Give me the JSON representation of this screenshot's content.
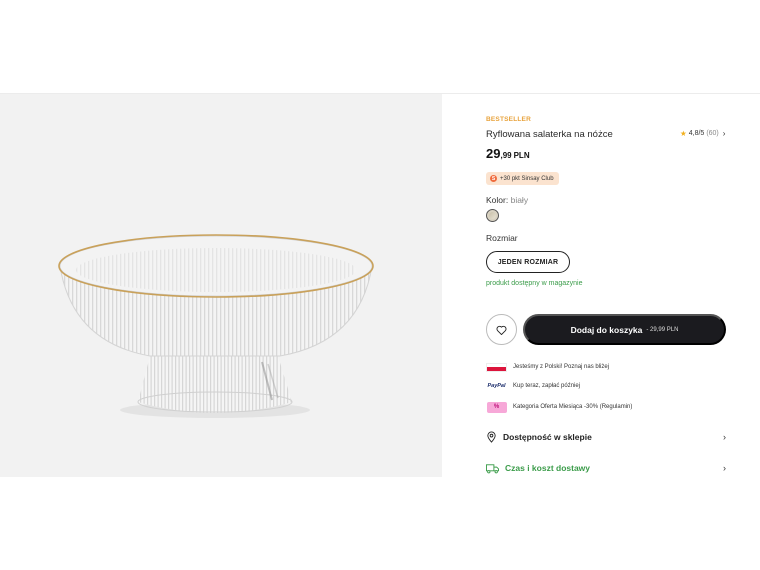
{
  "product": {
    "badge": "BESTSELLER",
    "title": "Ryflowana salaterka na nóżce",
    "rating": {
      "star_icon": "★",
      "score": "4,8/5",
      "count": "(60)",
      "chevron": "›"
    },
    "price": {
      "integer": "29",
      "decimal": ",99",
      "currency": "PLN"
    },
    "club": {
      "icon": "S",
      "text": "+30 pkt Sinsay Club"
    },
    "color": {
      "label": "Kolor:",
      "value": "biały"
    },
    "size": {
      "label": "Rozmiar",
      "button": "JEDEN ROZMIAR"
    },
    "stock_status": "produkt dostępny w magazynie",
    "cart": {
      "label": "Dodaj do koszyka",
      "price": "- 29,99 PLN"
    }
  },
  "promos": [
    {
      "icon": "poland-flag-icon",
      "text": "Jesteśmy z Polski! Poznaj nas bliżej"
    },
    {
      "icon": "paypal-icon",
      "icon_text": "PayPal",
      "text": "Kup teraz, zapłać później"
    },
    {
      "icon": "tag-icon",
      "icon_text": "%",
      "text": "Kategoria Oferta Miesiąca -30% (Regulamin)"
    }
  ],
  "links": {
    "store": {
      "label": "Dostępność w sklepie",
      "icon": "location-pin-icon",
      "chevron": "›"
    },
    "delivery": {
      "label": "Czas i koszt dostawy",
      "icon": "truck-icon",
      "chevron": "›"
    }
  },
  "colors": {
    "accent_badge": "#e8a33c",
    "in_stock_green": "#3b9c4a",
    "cart_button": "#1b1b1f",
    "club_bg": "#fbe3cf",
    "flag_red": "#dc143c"
  }
}
